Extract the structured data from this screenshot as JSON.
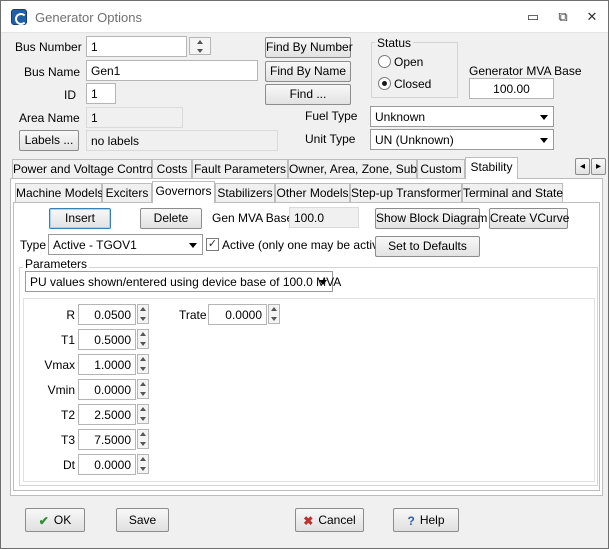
{
  "window": {
    "title": "Generator Options",
    "minimize": "▭",
    "restore": "⧉",
    "close": "✕"
  },
  "header": {
    "bus_number_label": "Bus Number",
    "bus_number": "1",
    "bus_name_label": "Bus Name",
    "bus_name": "Gen1",
    "id_label": "ID",
    "id": "1",
    "area_name_label": "Area Name",
    "area_name": "1",
    "labels_button": "Labels ...",
    "labels_value": "no labels",
    "find_by_number": "Find By Number",
    "find_by_name": "Find By Name",
    "find": "Find ...",
    "status_label": "Status",
    "status_open": "Open",
    "status_closed": "Closed",
    "mva_base_label": "Generator MVA Base",
    "mva_base": "100.00",
    "fuel_type_label": "Fuel Type",
    "fuel_type": "Unknown",
    "unit_type_label": "Unit Type",
    "unit_type": "UN (Unknown)"
  },
  "tabs": [
    "Power and Voltage Control",
    "Costs",
    "Fault Parameters",
    "Owner, Area, Zone, Sub",
    "Custom",
    "Stability"
  ],
  "tab_scroll": {
    "left": "◂",
    "right": "▸"
  },
  "subtabs": [
    "Machine Models",
    "Exciters",
    "Governors",
    "Stabilizers",
    "Other Models",
    "Step-up Transformer",
    "Terminal and State"
  ],
  "governors": {
    "insert": "Insert",
    "delete": "Delete",
    "gen_mva_base_label": "Gen MVA Base",
    "gen_mva_base": "100.0",
    "show_block_diagram": "Show Block Diagram",
    "create_vcurve": "Create VCurve",
    "type_label": "Type",
    "type_value": "Active - TGOV1",
    "active_check": "✓",
    "active_label": "Active (only one may be active)",
    "set_defaults": "Set to Defaults",
    "parameters_label": "Parameters",
    "pu_select": "PU values shown/entered using device base of 100.0 MVA",
    "params": [
      {
        "name": "R",
        "value": "0.0500"
      },
      {
        "name": "T1",
        "value": "0.5000"
      },
      {
        "name": "Vmax",
        "value": "1.0000"
      },
      {
        "name": "Vmin",
        "value": "0.0000"
      },
      {
        "name": "T2",
        "value": "2.5000"
      },
      {
        "name": "T3",
        "value": "7.5000"
      },
      {
        "name": "Dt",
        "value": "0.0000"
      }
    ],
    "trate": {
      "name": "Trate",
      "value": "0.0000"
    }
  },
  "footer": {
    "ok": "OK",
    "save": "Save",
    "cancel": "Cancel",
    "help": "Help",
    "ok_icon": "✔",
    "cancel_icon": "✖",
    "help_icon": "?"
  },
  "colors": {
    "ok_green": "#2e8b2e",
    "cancel_red": "#c0302a",
    "help_blue": "#2a5fa8"
  }
}
